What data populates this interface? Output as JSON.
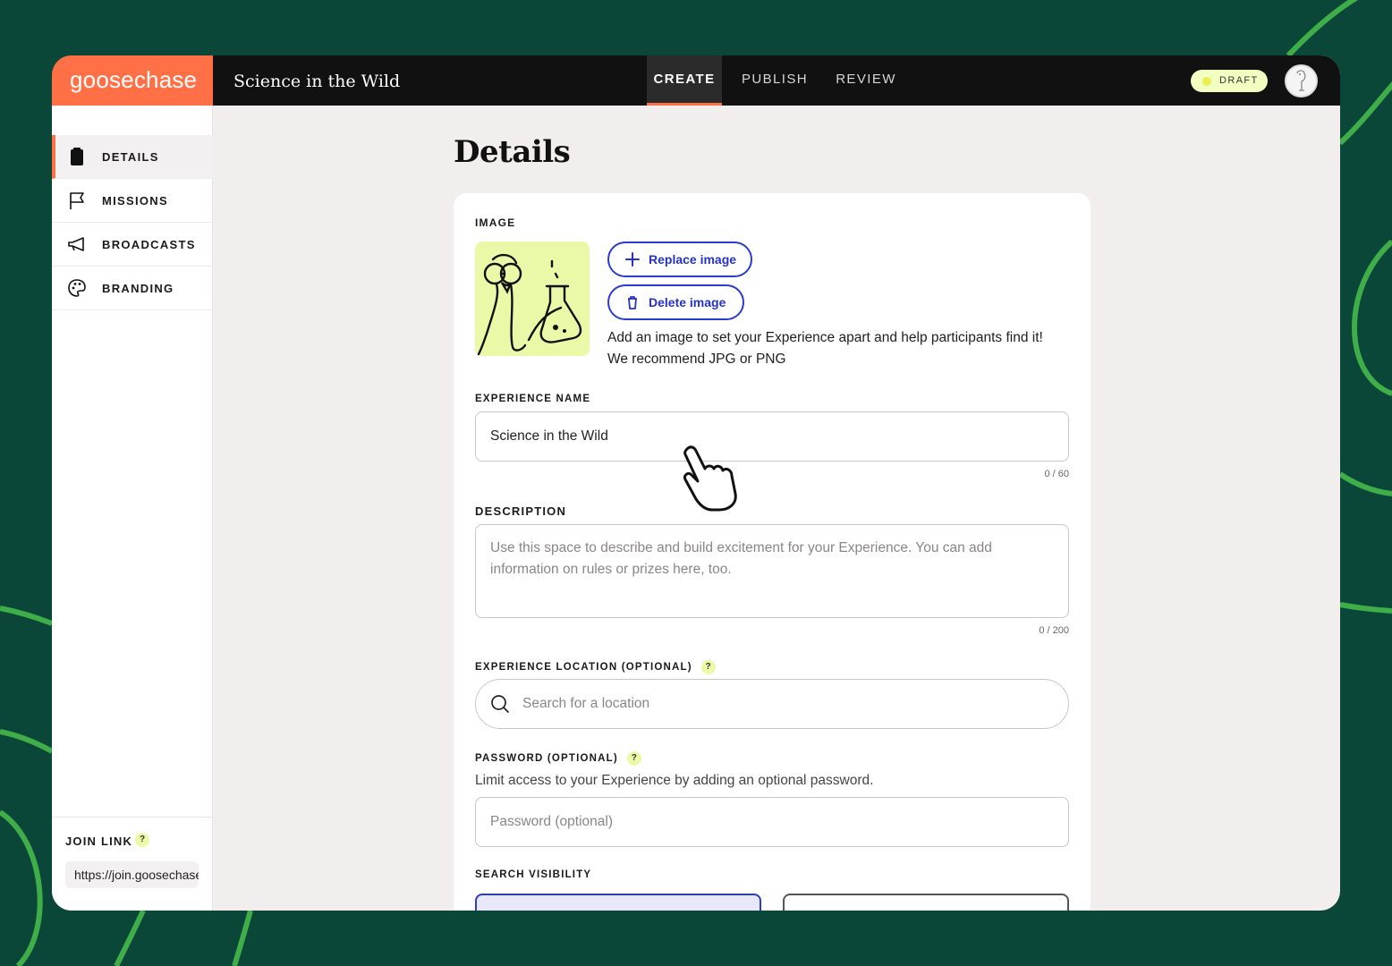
{
  "app": {
    "logo": "goosechase",
    "experience_title": "Science in the Wild",
    "status_badge": "DRAFT",
    "tabs": [
      {
        "label": "CREATE",
        "active": true
      },
      {
        "label": "PUBLISH",
        "active": false
      },
      {
        "label": "REVIEW",
        "active": false
      }
    ]
  },
  "sidebar": {
    "items": [
      {
        "label": "DETAILS",
        "icon": "clipboard-icon",
        "active": true
      },
      {
        "label": "MISSIONS",
        "icon": "flag-icon",
        "active": false
      },
      {
        "label": "BROADCASTS",
        "icon": "megaphone-icon",
        "active": false
      },
      {
        "label": "BRANDING",
        "icon": "palette-icon",
        "active": false
      }
    ],
    "join": {
      "label": "JOIN LINK",
      "help": "?",
      "url": "https://join.goosechase.ai"
    }
  },
  "main": {
    "title": "Details",
    "image": {
      "label": "IMAGE",
      "replace_label": "Replace image",
      "delete_label": "Delete image",
      "help_line1": "Add an image to set your Experience apart and help participants find it!",
      "help_line2": "We recommend JPG or PNG"
    },
    "name": {
      "label": "EXPERIENCE NAME",
      "value": "Science in the Wild",
      "counter": "0 / 60"
    },
    "description": {
      "label": "DESCRIPTION",
      "placeholder": "Use this space to describe and build excitement for your Experience. You can add information on rules or prizes here, too.",
      "counter": "0 / 200"
    },
    "location": {
      "label": "EXPERIENCE LOCATION (OPTIONAL)",
      "help": "?",
      "placeholder": "Search for a location"
    },
    "password": {
      "label": "PASSWORD (OPTIONAL)",
      "help": "?",
      "description": "Limit access to your Experience by adding an optional password.",
      "placeholder": "Password (optional)"
    },
    "visibility": {
      "label": "SEARCH VISIBILITY"
    }
  },
  "colors": {
    "brand_orange": "#ff7047",
    "background_green": "#0b4738",
    "accent_green": "#3fae49",
    "button_blue": "#2a3bd0",
    "thumb_yellow": "#e9f9a8"
  }
}
